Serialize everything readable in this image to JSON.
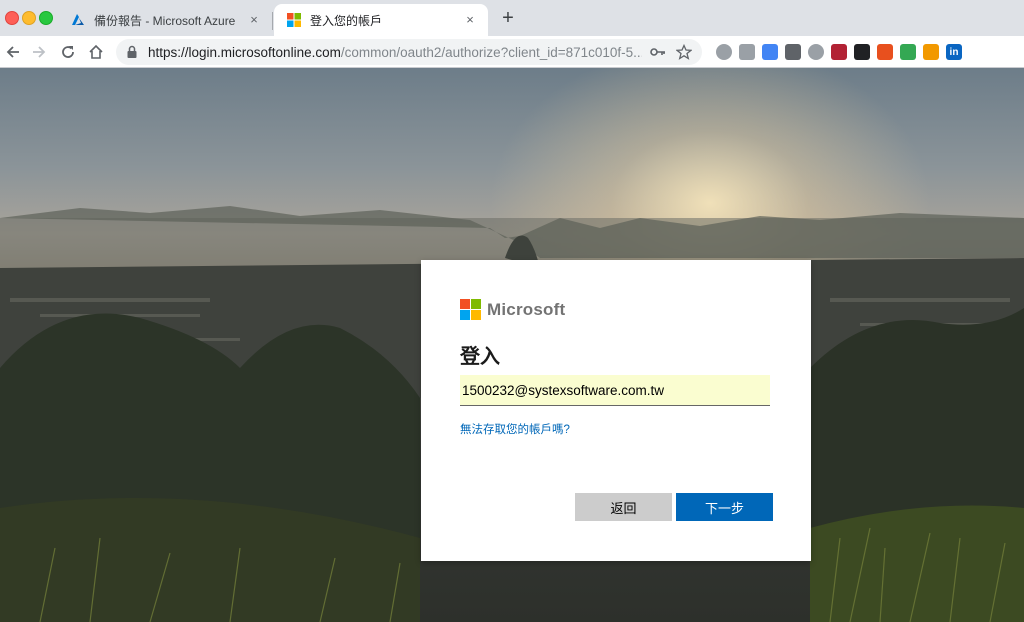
{
  "browser": {
    "tabs": [
      {
        "title": "備份報告 - Microsoft Azure",
        "close": "×",
        "active": false,
        "icon": "azure-icon"
      },
      {
        "title": "登入您的帳戶",
        "close": "×",
        "active": true,
        "icon": "microsoft-icon"
      }
    ],
    "new_tab": "+",
    "url_host": "https://login.microsoftonline.com",
    "url_path": "/common/oauth2/authorize?client_id=871c010f-5...",
    "extensions": [
      {
        "name": "extension-circle-icon",
        "color": "#9aa0a6"
      },
      {
        "name": "google-drive-icon",
        "color": "#9aa0a6"
      },
      {
        "name": "google-translate-icon",
        "color": "#4285f4"
      },
      {
        "name": "keep-icon",
        "color": "#5f6368"
      },
      {
        "name": "target-icon",
        "color": "#9aa0a6"
      },
      {
        "name": "us-flag-icon",
        "color": "#b22234"
      },
      {
        "name": "media-icon",
        "color": "#202124"
      },
      {
        "name": "sync-icon",
        "color": "#e8501e"
      },
      {
        "name": "chat-icon",
        "color": "#34a853"
      },
      {
        "name": "play-icon",
        "color": "#f29900"
      },
      {
        "name": "linkedin-icon",
        "color": "#0a66c2",
        "label": "in"
      }
    ]
  },
  "login": {
    "brand": "Microsoft",
    "title": "登入",
    "email_value": "1500232@systexsoftware.com.tw",
    "cant_access": "無法存取您的帳戶嗎?",
    "back_label": "返回",
    "next_label": "下一步",
    "logo_colors": [
      "#f25022",
      "#7fba00",
      "#00a4ef",
      "#ffb900"
    ],
    "accent": "#0067b8"
  }
}
